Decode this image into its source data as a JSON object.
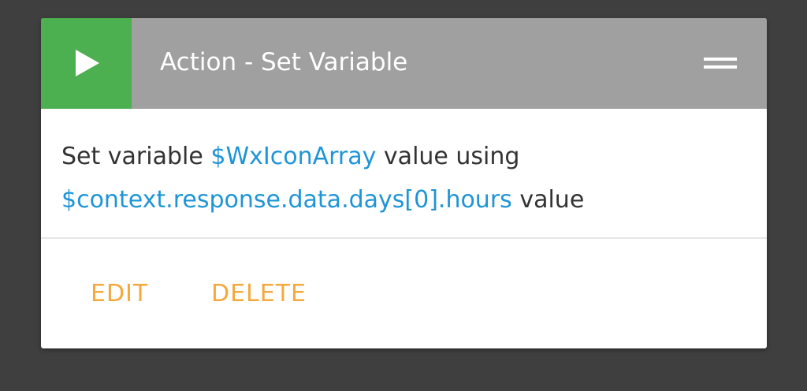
{
  "card": {
    "title": "Action - Set Variable",
    "play_icon": "play-icon",
    "menu_icon": "drag-handle-icon",
    "description": {
      "prefix": "Set variable ",
      "variable": "$WxIconArray",
      "middle": " value using",
      "source": "$context.response.data.days[0].hours",
      "suffix": " value"
    },
    "actions": {
      "edit_label": "EDIT",
      "delete_label": "DELETE"
    }
  },
  "colors": {
    "background": "#3f3f3f",
    "header": "#a0a0a0",
    "play_button": "#4caf50",
    "variable_text": "#1e95d6",
    "action_text": "#f5a83b"
  }
}
